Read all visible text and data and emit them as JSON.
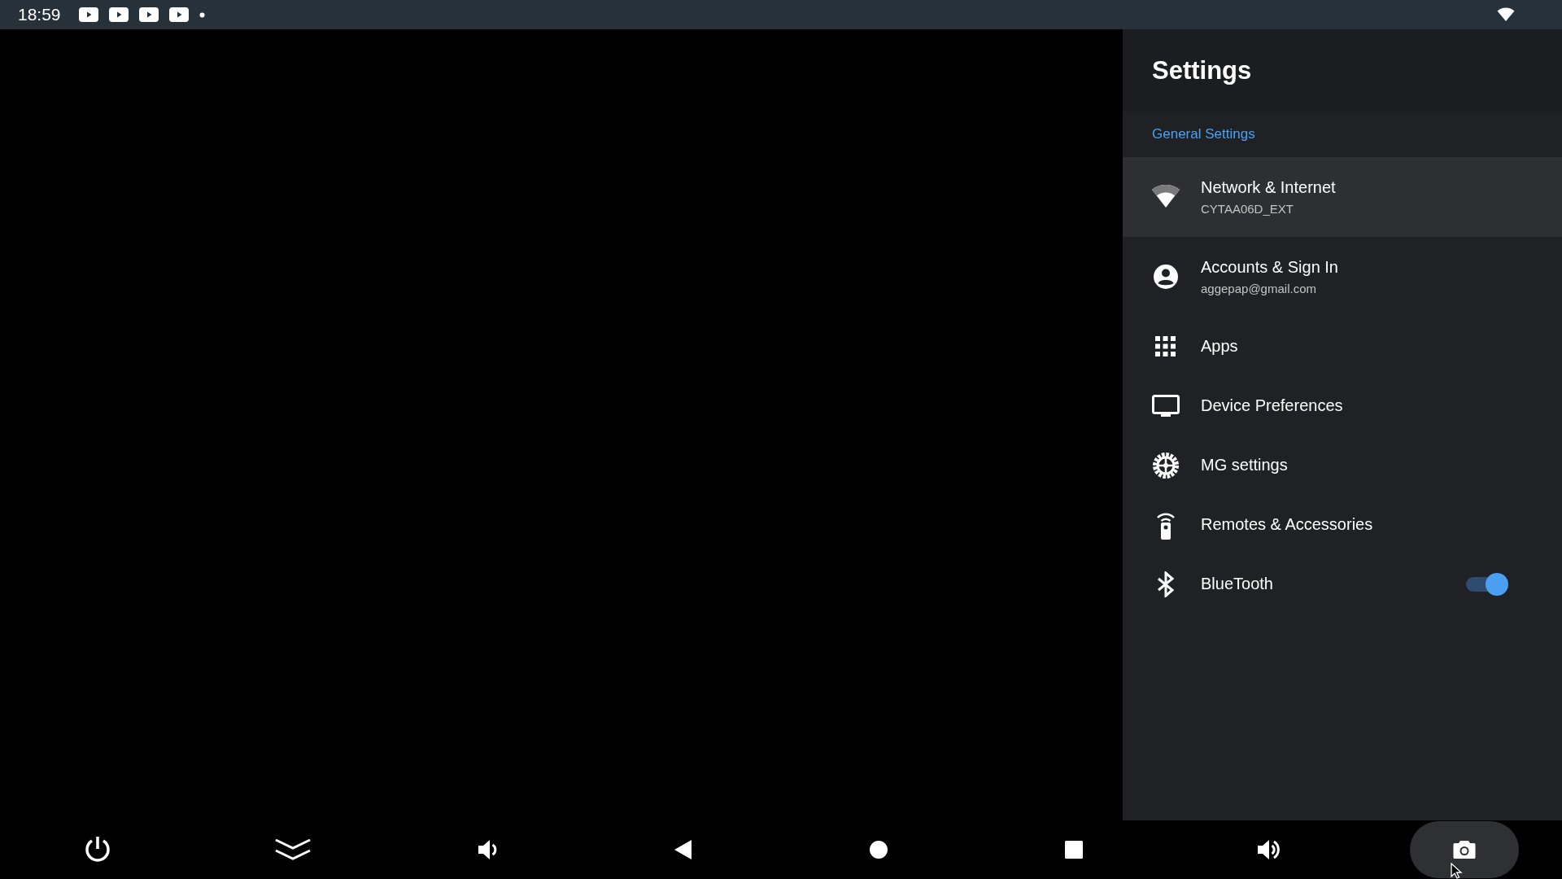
{
  "status_bar": {
    "time": "18:59",
    "notifications": [
      {
        "kind": "video"
      },
      {
        "kind": "video"
      },
      {
        "kind": "video"
      },
      {
        "kind": "video"
      },
      {
        "kind": "dot"
      }
    ],
    "indicators": [
      {
        "kind": "wifi"
      }
    ]
  },
  "settings": {
    "title": "Settings",
    "section": "General Settings",
    "items": [
      {
        "kind": "wifi",
        "label": "Network & Internet",
        "subtitle": "CYTAA06D_EXT",
        "selected": true
      },
      {
        "kind": "account",
        "label": "Accounts & Sign In",
        "subtitle": "aggepap@gmail.com",
        "selected": false
      },
      {
        "kind": "apps",
        "label": "Apps",
        "selected": false
      },
      {
        "kind": "tv",
        "label": "Device Preferences",
        "selected": false
      },
      {
        "kind": "gear",
        "label": "MG settings",
        "selected": false
      },
      {
        "kind": "remote",
        "label": "Remotes & Accessories",
        "selected": false
      },
      {
        "kind": "bluetooth",
        "label": "BlueTooth",
        "selected": false,
        "switch": {
          "on": true
        }
      }
    ]
  },
  "nav_bar": {
    "buttons": [
      {
        "kind": "power",
        "selected": false
      },
      {
        "kind": "collapse",
        "selected": false
      },
      {
        "kind": "volume_down",
        "selected": false
      },
      {
        "kind": "back",
        "selected": false
      },
      {
        "kind": "home",
        "selected": false
      },
      {
        "kind": "recents",
        "selected": false
      },
      {
        "kind": "volume_up",
        "selected": false
      },
      {
        "kind": "screenshot",
        "selected": true
      }
    ]
  }
}
